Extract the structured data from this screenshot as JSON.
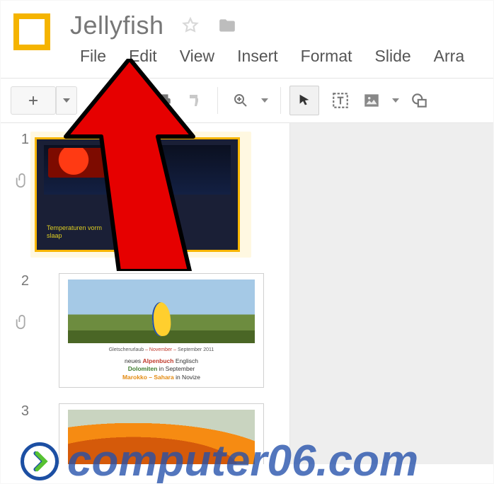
{
  "header": {
    "doc_title": "Jellyfish",
    "menu": [
      "File",
      "Edit",
      "View",
      "Insert",
      "Format",
      "Slide",
      "Arra"
    ]
  },
  "toolbar": {
    "new": "+"
  },
  "slides": [
    {
      "num": "1",
      "caption_l1": "Temperaturen vorm",
      "caption_l2": "slaap"
    },
    {
      "num": "2",
      "line1_a": "Gletscherurlaub ",
      "line1_b": "– November –",
      "line1_c": " September 2011",
      "l2a": "neues ",
      "l2b": "Alpenbuch",
      "l2c": " Englisch",
      "l3a": "Dolomiten",
      "l3b": " in September",
      "l4a": "Marokko ",
      "l4b": "– Sahara",
      "l4c": " in Novize"
    },
    {
      "num": "3"
    }
  ],
  "watermark": {
    "text": "computer06.com"
  }
}
